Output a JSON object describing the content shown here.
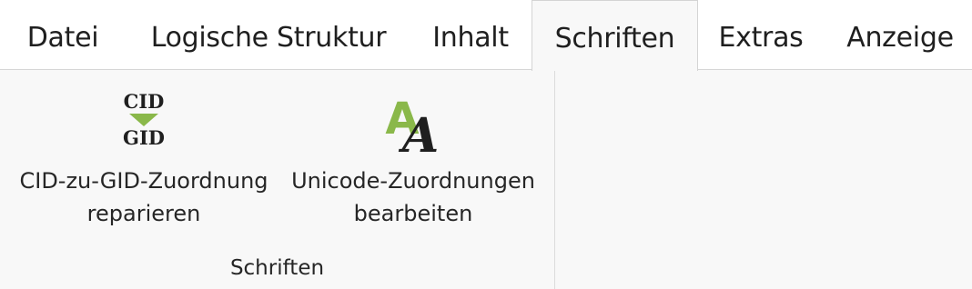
{
  "tabs": [
    {
      "label": "Datei"
    },
    {
      "label": "Logische Struktur"
    },
    {
      "label": "Inhalt"
    },
    {
      "label": "Schriften"
    },
    {
      "label": "Extras"
    },
    {
      "label": "Anzeige"
    }
  ],
  "active_tab": "Schriften",
  "ribbon": {
    "group_label": "Schriften",
    "buttons": [
      {
        "icon": "cid-to-gid-icon",
        "icon_text_top": "CID",
        "icon_text_bottom": "GID",
        "line1": "CID-zu-GID-Zuordnung",
        "line2": "reparieren"
      },
      {
        "icon": "unicode-font-icon",
        "line1": "Unicode-Zuordnungen",
        "line2": "bearbeiten"
      }
    ]
  },
  "colors": {
    "accent_green": "#8ab84a",
    "ribbon_bg": "#f8f8f8"
  }
}
